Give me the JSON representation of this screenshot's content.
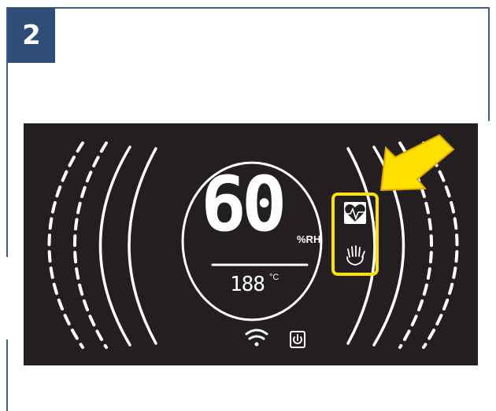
{
  "step": {
    "number": "2"
  },
  "display": {
    "humidity_value": "60",
    "humidity_unit": "%RH",
    "temperature_value": "188",
    "temperature_unit": "°C"
  },
  "icons": {
    "health_mode": "heart-pulse-icon",
    "sleep_mode": "hand-icon",
    "wifi": "wifi-icon",
    "power": "power-icon",
    "pointer": "arrow-icon"
  },
  "colors": {
    "panel": "#231f20",
    "highlight": "#ffe100",
    "badge": "#2e4d77",
    "frame": "#3d5f8d"
  }
}
